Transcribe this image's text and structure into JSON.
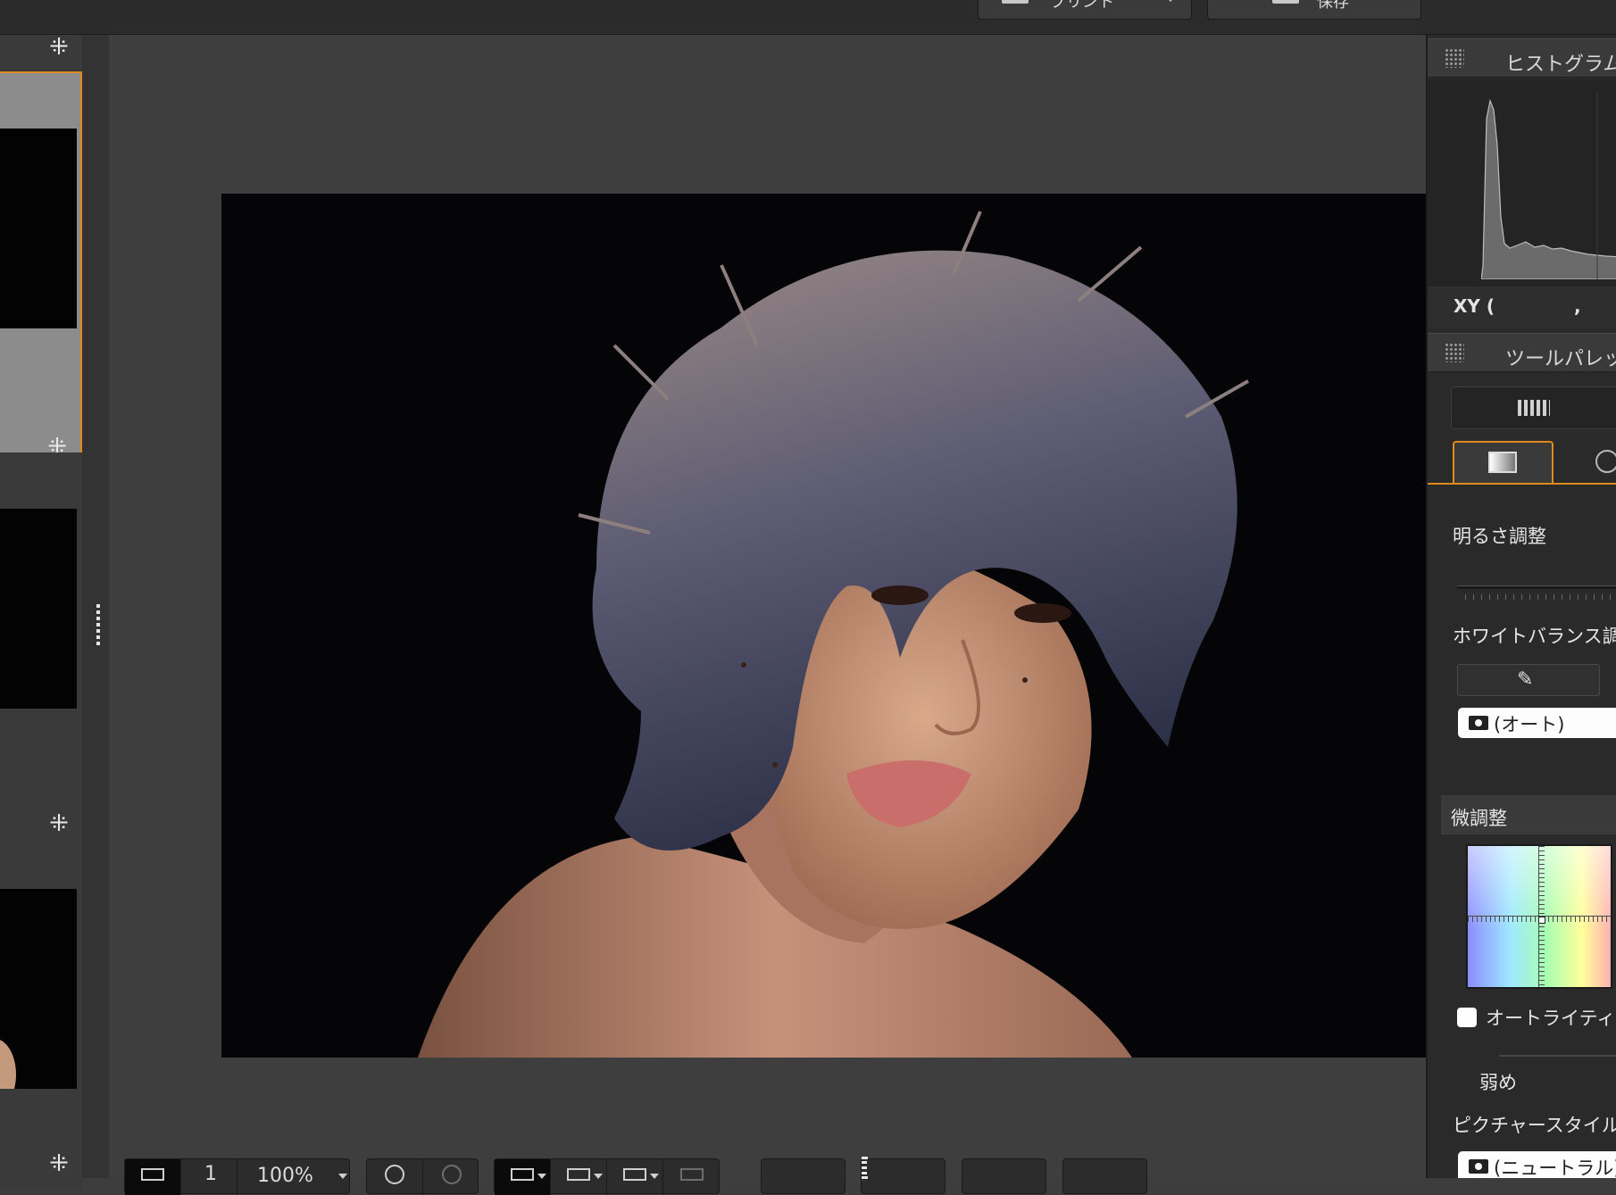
{
  "toolbar_top": {
    "print_label": "プリント",
    "save_label": "保存"
  },
  "filmstrip": {
    "thumbs": [
      {
        "selected": true
      },
      {
        "selected": false
      },
      {
        "selected": false
      }
    ]
  },
  "viewer": {
    "zoom": "100%"
  },
  "right_panel": {
    "histogram_title": "ヒストグラム",
    "xy_label": "XY (",
    "xy_comma": ",",
    "tool_palette_title": "ツールパレット",
    "brightness_label": "明るさ調整",
    "white_balance_label": "ホワイトバランス調整",
    "wb_select_value": "(オート)",
    "fine_tune_label": "微調整",
    "auto_lighting_label": "オートライティング",
    "weak_label": "弱め",
    "picture_style_label": "ピクチャースタイル",
    "picture_style_value": "(ニュートラル)"
  },
  "colors": {
    "accent": "#e08a1e",
    "panel": "#2a2a2a",
    "viewer_bg": "#3e3e3e"
  }
}
